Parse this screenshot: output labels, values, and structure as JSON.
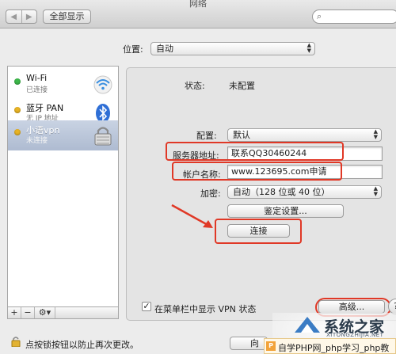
{
  "window": {
    "title": "网络"
  },
  "toolbar": {
    "back_label": "◀",
    "forward_label": "▶",
    "show_all_label": "全部显示",
    "search_placeholder": ""
  },
  "location": {
    "label": "位置:",
    "value": "自动"
  },
  "services": [
    {
      "name": "Wi-Fi",
      "status": "已连接",
      "dot_color": "#3db84a",
      "icon": "wifi-icon"
    },
    {
      "name": "蓝牙 PAN",
      "status": "无 IP 地址",
      "dot_color": "#e8b324",
      "icon": "bluetooth-icon"
    },
    {
      "name": "小语vpn",
      "status": "未连接",
      "dot_color": "#e8b324",
      "icon": "vpn-lock-icon",
      "selected": true
    }
  ],
  "sidebar_toolbar": {
    "add": "+",
    "remove": "−",
    "gear": "⚙▾"
  },
  "detail": {
    "status_label": "状态:",
    "status_value": "未配置",
    "config_label": "配置:",
    "config_value": "默认",
    "server_label": "服务器地址:",
    "server_value": "联系QQ30460244",
    "account_label": "帐户名称:",
    "account_value": "www.123695.com申请",
    "encryption_label": "加密:",
    "encryption_value": "自动（128 位或 40 位）",
    "auth_button": "鉴定设置...",
    "connect_button": "连接",
    "show_vpn_label": "在菜单栏中显示 VPN 状态",
    "advanced_button": "高级...",
    "help_label": "?"
  },
  "footer": {
    "lock_text": "点按锁按钮以防止再次更改。",
    "assist_button_partial": "向"
  },
  "overlay": {
    "watermark_title": "系统之家",
    "watermark_url": "XITONGZHIJIA.NET",
    "bottom_banner": "自学PHP网_php学习_php教"
  },
  "colors": {
    "highlight_red": "#e03826",
    "selected_row": "#aebbd1"
  }
}
